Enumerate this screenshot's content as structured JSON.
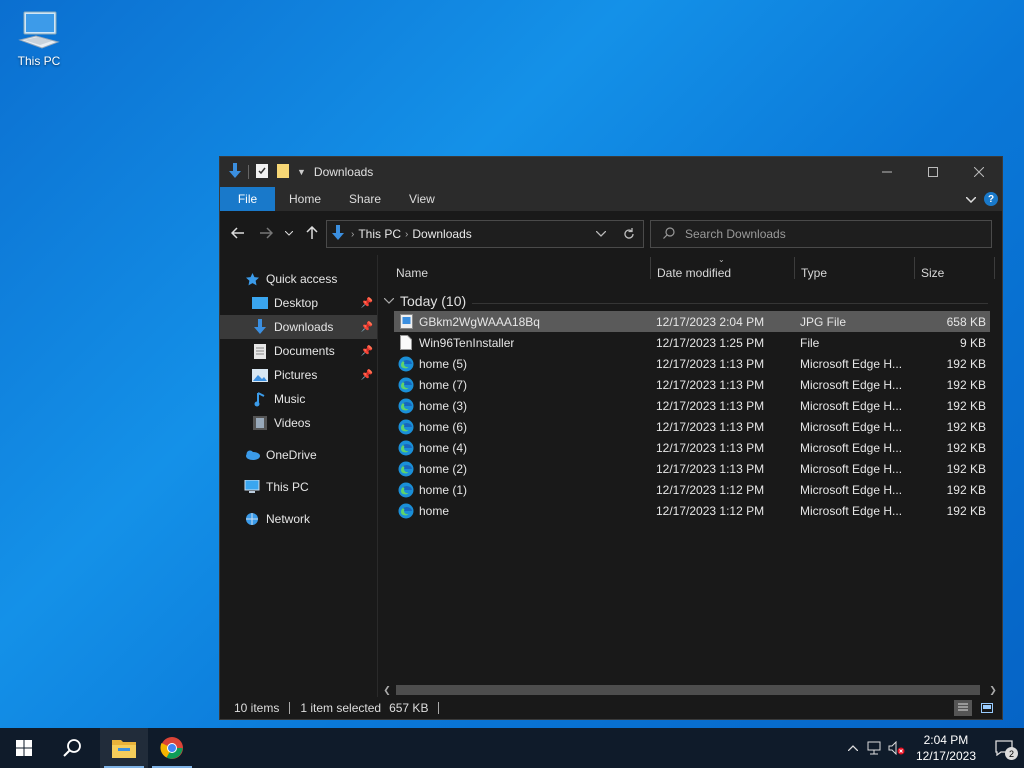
{
  "desktop": {
    "icons": [
      {
        "label": "This PC",
        "icon": "this-pc-icon"
      }
    ]
  },
  "window": {
    "title": "Downloads",
    "ribbon_tabs": [
      "File",
      "Home",
      "Share",
      "View"
    ],
    "help": "?",
    "breadcrumb": [
      "This PC",
      "Downloads"
    ],
    "search_placeholder": "Search Downloads"
  },
  "navpane": {
    "quick_access": "Quick access",
    "quick_items": [
      {
        "label": "Desktop",
        "pinned": true
      },
      {
        "label": "Downloads",
        "pinned": true,
        "selected": true
      },
      {
        "label": "Documents",
        "pinned": true
      },
      {
        "label": "Pictures",
        "pinned": true
      },
      {
        "label": "Music",
        "pinned": false
      },
      {
        "label": "Videos",
        "pinned": false
      }
    ],
    "onedrive": "OneDrive",
    "this_pc": "This PC",
    "network": "Network"
  },
  "columns": {
    "name": "Name",
    "date": "Date modified",
    "type": "Type",
    "size": "Size"
  },
  "group": {
    "label": "Today (10)"
  },
  "files": [
    {
      "name": "GBkm2WgWAAA18Bq",
      "date": "12/17/2023 2:04 PM",
      "type": "JPG File",
      "size": "658 KB",
      "icon": "jpg-file-icon",
      "selected": true
    },
    {
      "name": "Win96TenInstaller",
      "date": "12/17/2023 1:25 PM",
      "type": "File",
      "size": "9 KB",
      "icon": "blank-file-icon",
      "selected": false
    },
    {
      "name": "home (5)",
      "date": "12/17/2023 1:13 PM",
      "type": "Microsoft Edge H...",
      "size": "192 KB",
      "icon": "edge-icon",
      "selected": false
    },
    {
      "name": "home (7)",
      "date": "12/17/2023 1:13 PM",
      "type": "Microsoft Edge H...",
      "size": "192 KB",
      "icon": "edge-icon",
      "selected": false
    },
    {
      "name": "home (3)",
      "date": "12/17/2023 1:13 PM",
      "type": "Microsoft Edge H...",
      "size": "192 KB",
      "icon": "edge-icon",
      "selected": false
    },
    {
      "name": "home (6)",
      "date": "12/17/2023 1:13 PM",
      "type": "Microsoft Edge H...",
      "size": "192 KB",
      "icon": "edge-icon",
      "selected": false
    },
    {
      "name": "home (4)",
      "date": "12/17/2023 1:13 PM",
      "type": "Microsoft Edge H...",
      "size": "192 KB",
      "icon": "edge-icon",
      "selected": false
    },
    {
      "name": "home (2)",
      "date": "12/17/2023 1:13 PM",
      "type": "Microsoft Edge H...",
      "size": "192 KB",
      "icon": "edge-icon",
      "selected": false
    },
    {
      "name": "home (1)",
      "date": "12/17/2023 1:12 PM",
      "type": "Microsoft Edge H...",
      "size": "192 KB",
      "icon": "edge-icon",
      "selected": false
    },
    {
      "name": "home",
      "date": "12/17/2023 1:12 PM",
      "type": "Microsoft Edge H...",
      "size": "192 KB",
      "icon": "edge-icon",
      "selected": false
    }
  ],
  "status": {
    "count": "10 items",
    "selection": "1 item selected",
    "size": "657 KB"
  },
  "taskbar": {
    "clock_time": "2:04 PM",
    "clock_date": "12/17/2023",
    "notification_count": "2"
  },
  "colors": {
    "accent": "#1979ca",
    "window_bg": "#191919",
    "taskbar_bg": "#0f1b2a"
  }
}
